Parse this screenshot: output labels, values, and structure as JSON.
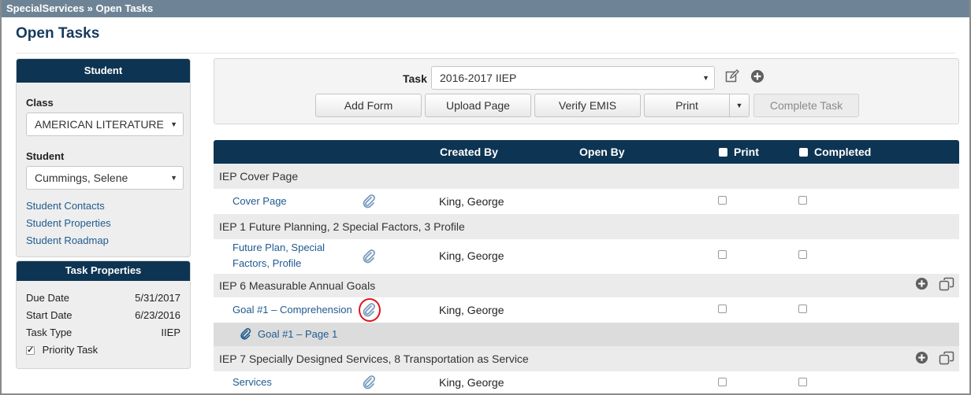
{
  "breadcrumb": {
    "root": "SpecialServices",
    "sep": "»",
    "current": "Open Tasks"
  },
  "page_title": "Open Tasks",
  "student_panel": {
    "title": "Student",
    "class_label": "Class",
    "class_value": "AMERICAN LITERATURE",
    "student_label": "Student",
    "student_value": "Cummings, Selene",
    "links": [
      "Student Contacts",
      "Student Properties",
      "Student Roadmap"
    ]
  },
  "task_properties": {
    "title": "Task Properties",
    "rows": [
      {
        "label": "Due Date",
        "value": "5/31/2017"
      },
      {
        "label": "Start Date",
        "value": "6/23/2016"
      },
      {
        "label": "Task Type",
        "value": "IIEP"
      }
    ],
    "priority_label": "Priority Task",
    "priority_checked": true
  },
  "toolbar": {
    "task_label": "Task",
    "task_value": "2016-2017 IIEP",
    "edit_icon": "edit-icon",
    "add_icon": "plus-circle-icon",
    "buttons": {
      "add_form": "Add Form",
      "upload_page": "Upload Page",
      "verify_emis": "Verify EMIS",
      "print": "Print",
      "complete_task": "Complete Task"
    }
  },
  "grid": {
    "headers": {
      "created_by": "Created By",
      "open_by": "Open By",
      "print": "Print",
      "completed": "Completed"
    },
    "groups": [
      {
        "title": "IEP Cover Page",
        "items": [
          {
            "name": "Cover Page",
            "created_by": "King, George"
          }
        ]
      },
      {
        "title": "IEP 1 Future Planning, 2 Special Factors, 3 Profile",
        "items": [
          {
            "name_line1": "Future Plan, Special",
            "name_line2": "Factors, Profile",
            "created_by": "King, George"
          }
        ]
      },
      {
        "title": "IEP 6 Measurable Annual Goals",
        "items": [
          {
            "name": "Goal #1 – Comprehension",
            "created_by": "King, George",
            "page": "Goal #1 – Page 1"
          }
        ]
      },
      {
        "title": "IEP 7 Specially Designed Services, 8 Transportation as Service",
        "items": [
          {
            "name": "Services",
            "created_by": "King, George"
          }
        ]
      }
    ]
  },
  "colors": {
    "header_navy": "#0d3453",
    "breadcrumb_bg": "#6e8496",
    "link_blue": "#1f5a8f",
    "highlight_red": "#e0141e"
  }
}
